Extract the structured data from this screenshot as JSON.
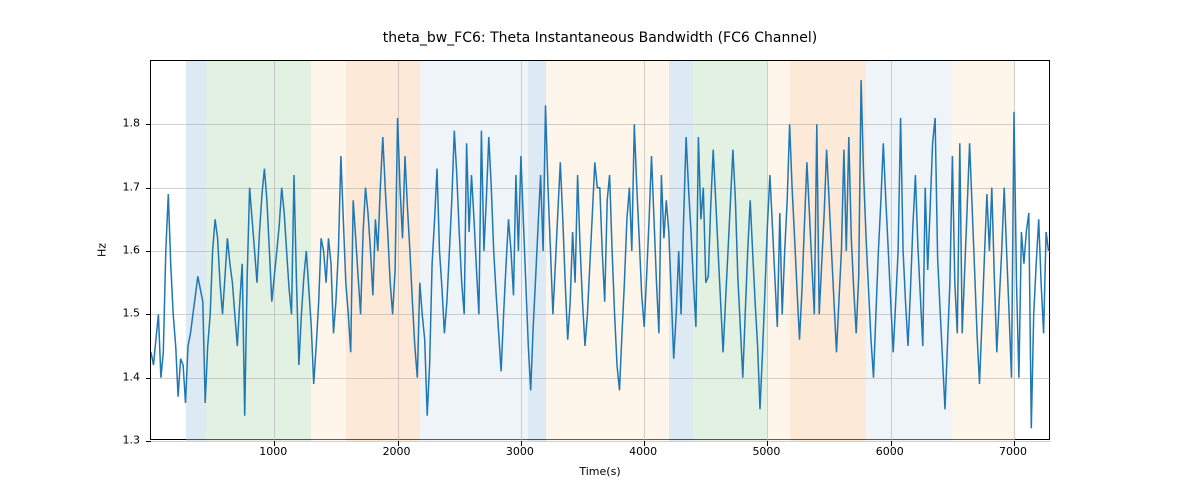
{
  "chart_data": {
    "type": "line",
    "title": "theta_bw_FC6: Theta Instantaneous Bandwidth (FC6 Channel)",
    "xlabel": "Time(s)",
    "ylabel": "Hz",
    "xlim": [
      0,
      7300
    ],
    "ylim": [
      1.3,
      1.9
    ],
    "xticks": [
      1000,
      2000,
      3000,
      4000,
      5000,
      6000,
      7000
    ],
    "yticks": [
      1.3,
      1.4,
      1.5,
      1.6,
      1.7,
      1.8
    ],
    "bands": [
      {
        "x0": 280,
        "x1": 450,
        "color": "blue"
      },
      {
        "x0": 450,
        "x1": 1300,
        "color": "green"
      },
      {
        "x0": 1300,
        "x1": 1580,
        "color": "lightorange"
      },
      {
        "x0": 1580,
        "x1": 2180,
        "color": "orange"
      },
      {
        "x0": 2180,
        "x1": 2350,
        "color": "lightblue"
      },
      {
        "x0": 2350,
        "x1": 3060,
        "color": "lightblue"
      },
      {
        "x0": 3060,
        "x1": 3200,
        "color": "blue"
      },
      {
        "x0": 3200,
        "x1": 4200,
        "color": "lightorange"
      },
      {
        "x0": 4200,
        "x1": 4400,
        "color": "blue"
      },
      {
        "x0": 4400,
        "x1": 5000,
        "color": "green"
      },
      {
        "x0": 5000,
        "x1": 5180,
        "color": "lightorange"
      },
      {
        "x0": 5180,
        "x1": 5800,
        "color": "orange"
      },
      {
        "x0": 5800,
        "x1": 6500,
        "color": "lightblue"
      },
      {
        "x0": 6500,
        "x1": 7000,
        "color": "lightorange"
      }
    ],
    "x": [
      0,
      20,
      40,
      60,
      80,
      100,
      120,
      140,
      160,
      180,
      200,
      220,
      240,
      260,
      280,
      300,
      320,
      340,
      360,
      380,
      400,
      420,
      440,
      460,
      480,
      500,
      520,
      540,
      560,
      580,
      600,
      620,
      640,
      660,
      680,
      700,
      720,
      740,
      760,
      780,
      800,
      820,
      840,
      860,
      880,
      900,
      920,
      940,
      960,
      980,
      1000,
      1020,
      1040,
      1060,
      1080,
      1100,
      1120,
      1140,
      1160,
      1180,
      1200,
      1220,
      1240,
      1260,
      1280,
      1300,
      1320,
      1340,
      1360,
      1380,
      1400,
      1420,
      1440,
      1460,
      1480,
      1500,
      1520,
      1540,
      1560,
      1580,
      1600,
      1620,
      1640,
      1660,
      1680,
      1700,
      1720,
      1740,
      1760,
      1780,
      1800,
      1820,
      1840,
      1860,
      1880,
      1900,
      1920,
      1940,
      1960,
      1980,
      2000,
      2020,
      2040,
      2060,
      2080,
      2100,
      2120,
      2140,
      2160,
      2180,
      2200,
      2220,
      2240,
      2260,
      2280,
      2300,
      2320,
      2340,
      2360,
      2380,
      2400,
      2420,
      2440,
      2460,
      2480,
      2500,
      2520,
      2540,
      2560,
      2580,
      2600,
      2620,
      2640,
      2660,
      2680,
      2700,
      2720,
      2740,
      2760,
      2780,
      2800,
      2820,
      2840,
      2860,
      2880,
      2900,
      2920,
      2940,
      2960,
      2980,
      3000,
      3020,
      3040,
      3060,
      3080,
      3100,
      3120,
      3140,
      3160,
      3180,
      3200,
      3220,
      3240,
      3260,
      3280,
      3300,
      3320,
      3340,
      3360,
      3380,
      3400,
      3420,
      3440,
      3460,
      3480,
      3500,
      3520,
      3540,
      3560,
      3580,
      3600,
      3620,
      3640,
      3660,
      3680,
      3700,
      3720,
      3740,
      3760,
      3780,
      3800,
      3820,
      3840,
      3860,
      3880,
      3900,
      3920,
      3940,
      3960,
      3980,
      4000,
      4020,
      4040,
      4060,
      4080,
      4100,
      4120,
      4140,
      4160,
      4180,
      4200,
      4220,
      4240,
      4260,
      4280,
      4300,
      4320,
      4340,
      4360,
      4380,
      4400,
      4420,
      4440,
      4460,
      4480,
      4500,
      4520,
      4540,
      4560,
      4580,
      4600,
      4620,
      4640,
      4660,
      4680,
      4700,
      4720,
      4740,
      4760,
      4780,
      4800,
      4820,
      4840,
      4860,
      4880,
      4900,
      4920,
      4940,
      4960,
      4980,
      5000,
      5020,
      5040,
      5060,
      5080,
      5100,
      5120,
      5140,
      5160,
      5180,
      5200,
      5220,
      5240,
      5260,
      5280,
      5300,
      5320,
      5340,
      5360,
      5380,
      5400,
      5420,
      5440,
      5460,
      5480,
      5500,
      5520,
      5540,
      5560,
      5580,
      5600,
      5620,
      5640,
      5660,
      5680,
      5700,
      5720,
      5740,
      5760,
      5780,
      5800,
      5820,
      5840,
      5860,
      5880,
      5900,
      5920,
      5940,
      5960,
      5980,
      6000,
      6020,
      6040,
      6060,
      6080,
      6100,
      6120,
      6140,
      6160,
      6180,
      6200,
      6220,
      6240,
      6260,
      6280,
      6300,
      6320,
      6340,
      6360,
      6380,
      6400,
      6420,
      6440,
      6460,
      6480,
      6500,
      6520,
      6540,
      6560,
      6580,
      6600,
      6620,
      6640,
      6660,
      6680,
      6700,
      6720,
      6740,
      6760,
      6780,
      6800,
      6820,
      6840,
      6860,
      6880,
      6900,
      6920,
      6940,
      6960,
      6980,
      7000,
      7020,
      7040,
      7060,
      7080,
      7100,
      7120,
      7140,
      7160,
      7180,
      7200,
      7220,
      7240,
      7260,
      7280
    ],
    "values": [
      1.44,
      1.42,
      1.46,
      1.5,
      1.4,
      1.44,
      1.6,
      1.69,
      1.58,
      1.5,
      1.45,
      1.37,
      1.43,
      1.42,
      1.36,
      1.45,
      1.47,
      1.5,
      1.53,
      1.56,
      1.54,
      1.52,
      1.36,
      1.45,
      1.5,
      1.6,
      1.65,
      1.62,
      1.55,
      1.5,
      1.56,
      1.62,
      1.58,
      1.55,
      1.5,
      1.45,
      1.52,
      1.58,
      1.34,
      1.56,
      1.7,
      1.65,
      1.6,
      1.55,
      1.63,
      1.69,
      1.73,
      1.68,
      1.6,
      1.52,
      1.56,
      1.6,
      1.64,
      1.7,
      1.66,
      1.6,
      1.54,
      1.5,
      1.72,
      1.55,
      1.42,
      1.5,
      1.56,
      1.6,
      1.54,
      1.48,
      1.39,
      1.45,
      1.52,
      1.62,
      1.6,
      1.55,
      1.62,
      1.58,
      1.47,
      1.52,
      1.6,
      1.75,
      1.65,
      1.55,
      1.5,
      1.44,
      1.68,
      1.62,
      1.56,
      1.5,
      1.63,
      1.7,
      1.66,
      1.6,
      1.53,
      1.65,
      1.6,
      1.7,
      1.78,
      1.7,
      1.63,
      1.55,
      1.5,
      1.57,
      1.81,
      1.7,
      1.62,
      1.75,
      1.67,
      1.6,
      1.52,
      1.45,
      1.4,
      1.55,
      1.5,
      1.46,
      1.34,
      1.42,
      1.58,
      1.65,
      1.73,
      1.6,
      1.54,
      1.47,
      1.52,
      1.6,
      1.68,
      1.79,
      1.72,
      1.63,
      1.55,
      1.5,
      1.77,
      1.63,
      1.72,
      1.65,
      1.57,
      1.5,
      1.79,
      1.6,
      1.68,
      1.78,
      1.7,
      1.6,
      1.53,
      1.47,
      1.41,
      1.5,
      1.58,
      1.65,
      1.6,
      1.53,
      1.72,
      1.6,
      1.75,
      1.65,
      1.55,
      1.45,
      1.38,
      1.48,
      1.56,
      1.64,
      1.72,
      1.6,
      1.83,
      1.7,
      1.6,
      1.5,
      1.58,
      1.66,
      1.74,
      1.65,
      1.55,
      1.46,
      1.52,
      1.63,
      1.55,
      1.72,
      1.61,
      1.52,
      1.45,
      1.5,
      1.58,
      1.66,
      1.74,
      1.7,
      1.7,
      1.6,
      1.52,
      1.68,
      1.72,
      1.6,
      1.5,
      1.42,
      1.38,
      1.47,
      1.55,
      1.65,
      1.7,
      1.6,
      1.8,
      1.7,
      1.62,
      1.53,
      1.48,
      1.56,
      1.65,
      1.75,
      1.65,
      1.55,
      1.47,
      1.72,
      1.62,
      1.68,
      1.63,
      1.53,
      1.43,
      1.5,
      1.6,
      1.5,
      1.65,
      1.78,
      1.7,
      1.63,
      1.55,
      1.48,
      1.78,
      1.65,
      1.7,
      1.55,
      1.56,
      1.67,
      1.76,
      1.68,
      1.6,
      1.52,
      1.44,
      1.52,
      1.6,
      1.68,
      1.76,
      1.68,
      1.56,
      1.48,
      1.4,
      1.5,
      1.6,
      1.68,
      1.6,
      1.52,
      1.45,
      1.35,
      1.44,
      1.54,
      1.64,
      1.72,
      1.64,
      1.56,
      1.48,
      1.66,
      1.5,
      1.6,
      1.68,
      1.8,
      1.7,
      1.62,
      1.54,
      1.46,
      1.54,
      1.64,
      1.74,
      1.66,
      1.58,
      1.5,
      1.8,
      1.5,
      1.58,
      1.66,
      1.76,
      1.68,
      1.6,
      1.52,
      1.44,
      1.52,
      1.6,
      1.76,
      1.6,
      1.78,
      1.62,
      1.54,
      1.47,
      1.56,
      1.87,
      1.72,
      1.62,
      1.54,
      1.46,
      1.4,
      1.5,
      1.6,
      1.68,
      1.77,
      1.68,
      1.6,
      1.52,
      1.44,
      1.52,
      1.6,
      1.81,
      1.6,
      1.52,
      1.45,
      1.54,
      1.64,
      1.72,
      1.61,
      1.53,
      1.45,
      1.7,
      1.57,
      1.67,
      1.77,
      1.81,
      1.59,
      1.51,
      1.43,
      1.35,
      1.45,
      1.55,
      1.75,
      1.55,
      1.47,
      1.77,
      1.47,
      1.57,
      1.67,
      1.77,
      1.67,
      1.57,
      1.47,
      1.39,
      1.49,
      1.59,
      1.69,
      1.6,
      1.7,
      1.56,
      1.44,
      1.52,
      1.6,
      1.7,
      1.6,
      1.5,
      1.4,
      1.82,
      1.55,
      1.4,
      1.63,
      1.58,
      1.63,
      1.66,
      1.32,
      1.5,
      1.58,
      1.65,
      1.55,
      1.47,
      1.63,
      1.6
    ]
  }
}
